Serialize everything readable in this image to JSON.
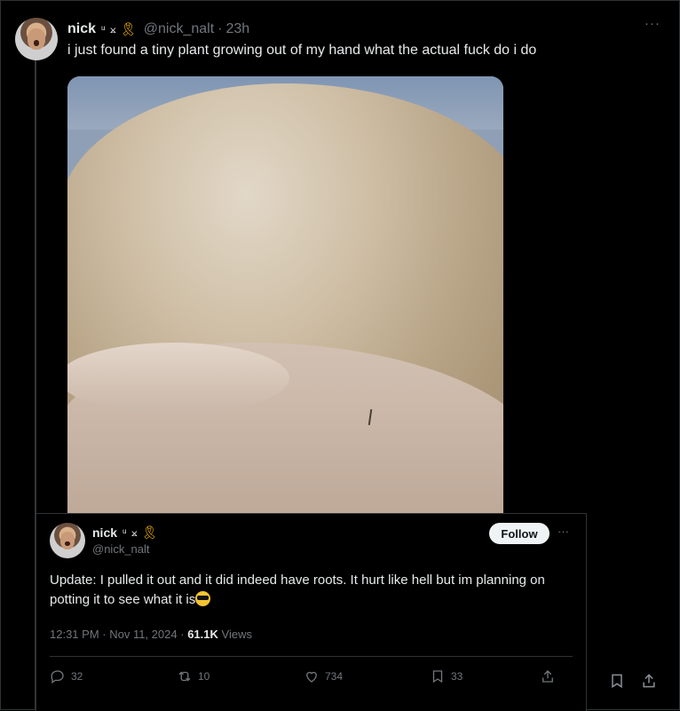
{
  "tweet": {
    "author_name": "nick",
    "name_icons": "ᵘ ⨲",
    "handle": "@nick_nalt",
    "age": "23h",
    "separator": "·",
    "text": "i just found a tiny plant growing out of my hand what the actual fuck do i do",
    "more_label": "···",
    "image_alt": "photo of a hand with a tiny sprout against a tan leather surface"
  },
  "quote": {
    "author_name": "nick",
    "handle": "@nick_nalt",
    "follow_label": "Follow",
    "more_label": "···",
    "text": "Update: I pulled it out and it did indeed have roots. It hurt like hell but im planning on potting it to see what it is",
    "time": "12:31 PM",
    "date": "Nov 11, 2024",
    "views_count": "61.1K",
    "views_label": "Views",
    "replies": "32",
    "reposts": "10",
    "likes": "734",
    "bookmarks": "33"
  },
  "icons": {
    "reply": "reply-icon",
    "repost": "repost-icon",
    "like": "heart-icon",
    "bookmark": "bookmark-icon",
    "share": "share-icon",
    "ribbon": "ribbon-icon"
  },
  "colors": {
    "background": "#000000",
    "text": "#e7e9ea",
    "muted": "#71767b",
    "border": "#2f3336",
    "ribbon": "#f4b400"
  }
}
